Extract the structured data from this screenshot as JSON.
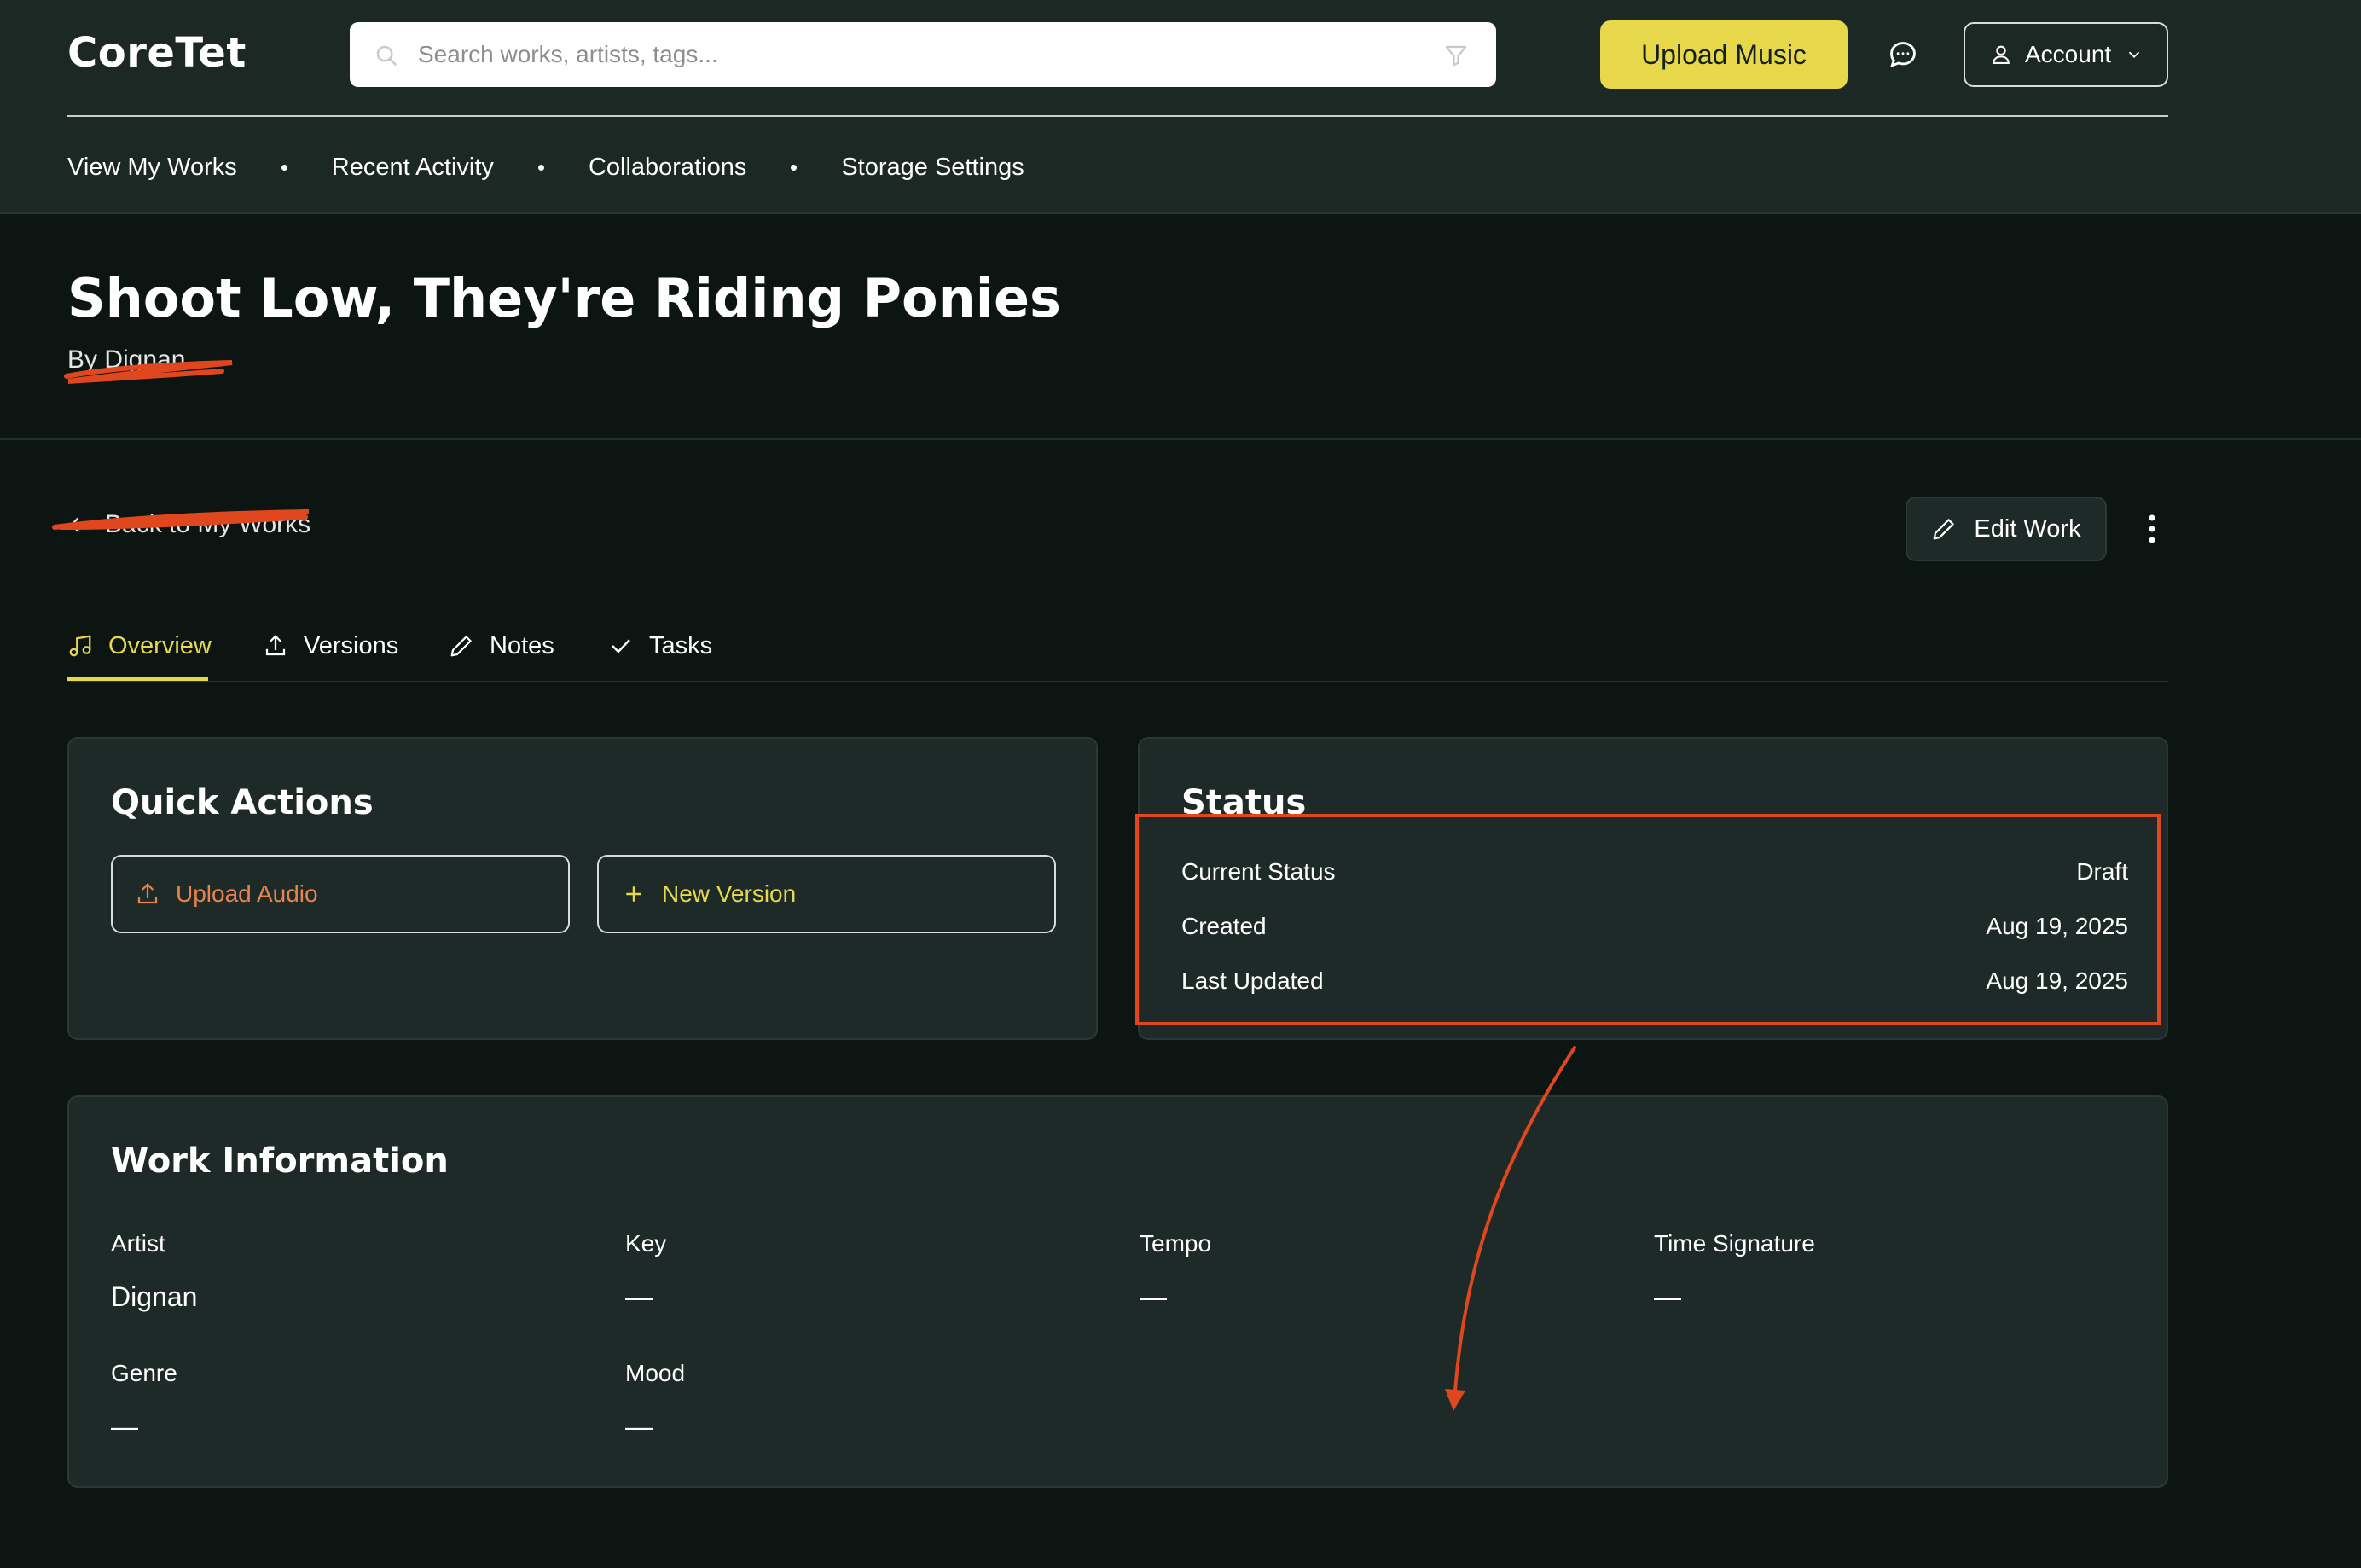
{
  "header": {
    "logo": "CoreTet",
    "search_placeholder": "Search works, artists, tags...",
    "upload_label": "Upload Music",
    "account_label": "Account",
    "nav": [
      "View My Works",
      "Recent Activity",
      "Collaborations",
      "Storage Settings"
    ]
  },
  "work": {
    "title": "Shoot Low, They're Riding Ponies",
    "byline": "By Dignan"
  },
  "toolbar": {
    "back_label": "Back to My Works",
    "edit_label": "Edit Work"
  },
  "tabs": [
    {
      "label": "Overview",
      "icon": "music-note-icon",
      "active": true
    },
    {
      "label": "Versions",
      "icon": "upload-icon",
      "active": false
    },
    {
      "label": "Notes",
      "icon": "pencil-icon",
      "active": false
    },
    {
      "label": "Tasks",
      "icon": "check-icon",
      "active": false
    }
  ],
  "quick_actions": {
    "title": "Quick Actions",
    "upload_audio": "Upload Audio",
    "new_version": "New Version"
  },
  "status": {
    "title": "Status",
    "rows": [
      {
        "label": "Current Status",
        "value": "Draft"
      },
      {
        "label": "Created",
        "value": "Aug 19, 2025"
      },
      {
        "label": "Last Updated",
        "value": "Aug 19, 2025"
      }
    ]
  },
  "work_info": {
    "title": "Work Information",
    "fields": [
      {
        "label": "Artist",
        "value": "Dignan"
      },
      {
        "label": "Key",
        "value": "—"
      },
      {
        "label": "Tempo",
        "value": "—"
      },
      {
        "label": "Time Signature",
        "value": "—"
      },
      {
        "label": "Genre",
        "value": "—"
      },
      {
        "label": "Mood",
        "value": "—"
      }
    ]
  },
  "colors": {
    "accent": "#e6d84a",
    "annotation": "#e0471f",
    "upload_action": "#e8834f",
    "background": "#0d1513",
    "card": "#1e2a27"
  }
}
